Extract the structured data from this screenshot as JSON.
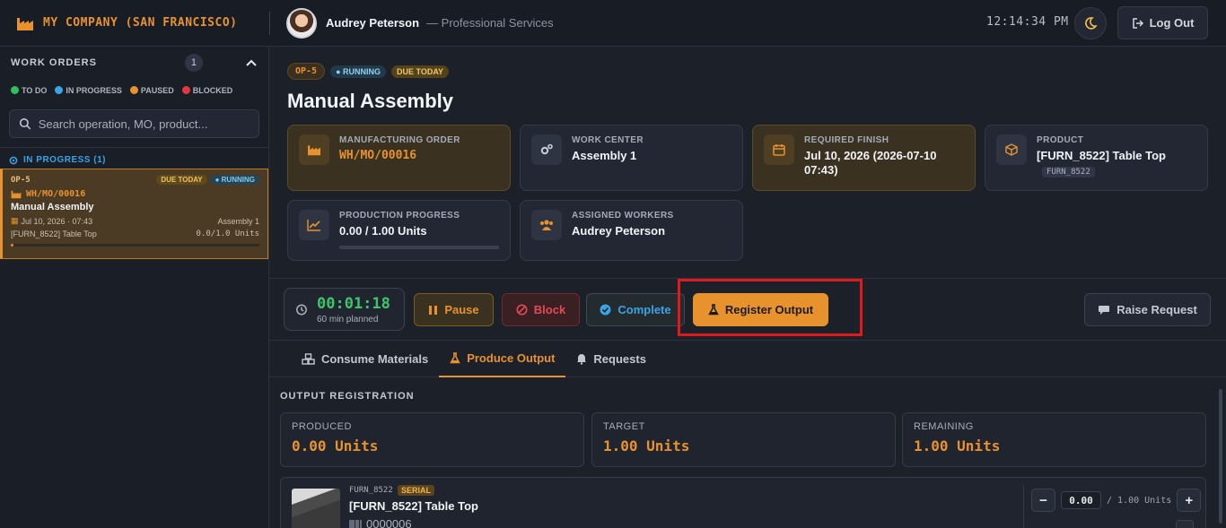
{
  "app": {
    "brand": "MY COMPANY (SAN FRANCISCO)",
    "user_name": "Audrey Peterson",
    "user_role": "— Professional Services",
    "clock": "12:14:34 PM",
    "logout_label": "Log Out"
  },
  "sidebar": {
    "title": "WORK ORDERS",
    "count": "1",
    "legend": [
      "TO DO",
      "IN PROGRESS",
      "PAUSED",
      "BLOCKED"
    ],
    "legend_colors": [
      "#2fbf5f",
      "#3aa4e4",
      "#e8922d",
      "#e03a3a"
    ],
    "search_placeholder": "Search operation, MO, product...",
    "section_label": "IN PROGRESS (1)",
    "card": {
      "op": "OP-5",
      "due_badge": "DUE TODAY",
      "status_badge": "RUNNING",
      "mo": "WH/MO/00016",
      "name": "Manual Assembly",
      "date": "Jul 10, 2026 · 07:43",
      "workcenter": "Assembly 1",
      "product": "[FURN_8522] Table Top",
      "qty": "0.0/1.0 Units",
      "progress": 0.0
    }
  },
  "header": {
    "op_chip": "OP-5",
    "status_chip": "RUNNING",
    "due_chip": "DUE TODAY",
    "title": "Manual Assembly"
  },
  "info": {
    "mo_label": "MANUFACTURING ORDER",
    "mo_value": "WH/MO/00016",
    "wc_label": "WORK CENTER",
    "wc_value": "Assembly 1",
    "finish_label": "REQUIRED FINISH",
    "finish_value": "Jul 10, 2026 (2026-07-10 07:43)",
    "product_label": "PRODUCT",
    "product_value": "[FURN_8522] Table Top",
    "product_tag": "FURN_8522",
    "progress_label": "PRODUCTION PROGRESS",
    "progress_value": "0.00 / 1.00 Units",
    "workers_label": "ASSIGNED WORKERS",
    "workers_value": "Audrey Peterson"
  },
  "actions": {
    "timer": "00:01:18",
    "timer_sub": "60 min planned",
    "pause": "Pause",
    "block": "Block",
    "complete": "Complete",
    "register": "Register Output",
    "raise": "Raise Request"
  },
  "tabs": [
    "Consume Materials",
    "Produce Output",
    "Requests"
  ],
  "output": {
    "section_title": "OUTPUT REGISTRATION",
    "produced_label": "PRODUCED",
    "produced_value": "0.00 Units",
    "target_label": "TARGET",
    "target_value": "1.00 Units",
    "remaining_label": "REMAINING",
    "remaining_value": "1.00 Units",
    "product_sku": "FURN_8522",
    "serial_badge": "SERIAL",
    "product_name": "[FURN_8522] Table Top",
    "serial_number": "0000006",
    "qty_value": "0.00",
    "qty_unit": "/ 1.00 Units",
    "minus": "−",
    "plus": "+"
  },
  "colors": {
    "accent": "#e8922d",
    "running": "#3aa4e4",
    "timer": "#3cc66a",
    "highlight": "#e01a1a"
  }
}
